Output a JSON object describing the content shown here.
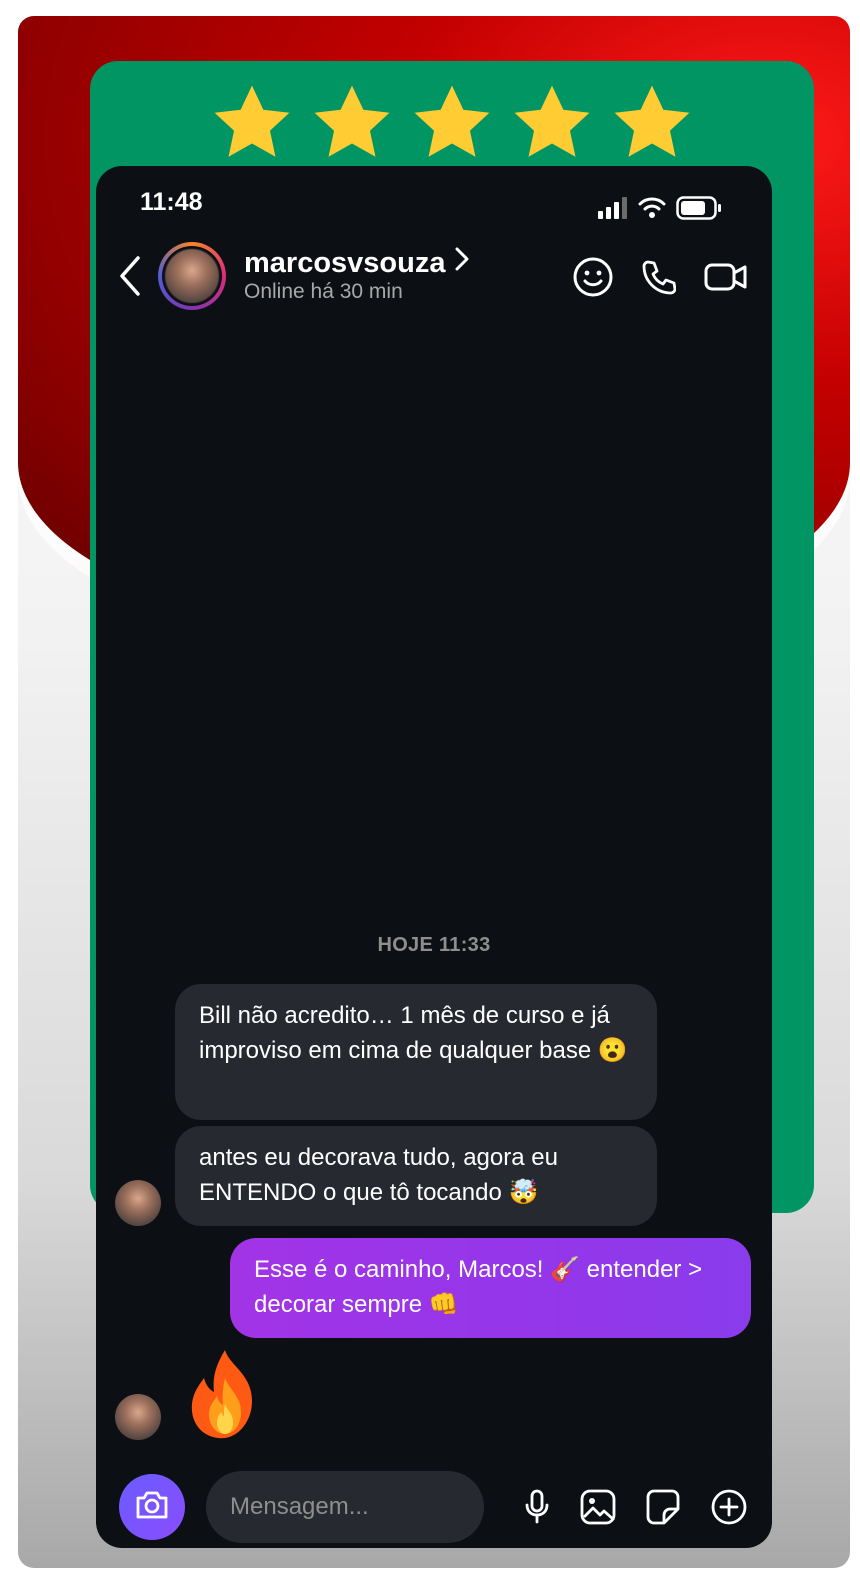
{
  "rating": {
    "stars": 5,
    "max": 5,
    "star_color": "#ffcc33",
    "card_color": "#009563"
  },
  "status_bar": {
    "time": "11:48"
  },
  "chat_header": {
    "username": "marcosvsouza",
    "status": "Online há 30 min"
  },
  "date_separator": "HOJE 11:33",
  "messages": [
    {
      "from": "them",
      "text": "Bill não acredito… 1 mês de curso e já improviso em cima de qualquer base 😮"
    },
    {
      "from": "them",
      "text": "antes eu decorava tudo, agora eu ENTENDO o que tô tocando 🤯"
    },
    {
      "from": "me",
      "text": "Esse é o caminho, Marcos! 🎸 entender > decorar sempre 👊"
    },
    {
      "from": "them",
      "text": "🔥",
      "type": "emoji-reaction"
    }
  ],
  "composer": {
    "placeholder": "Mensagem...",
    "value": ""
  },
  "colors": {
    "background": "#0c1014",
    "incoming_bubble": "#262a30",
    "outgoing_bubble": "#9436ea"
  }
}
